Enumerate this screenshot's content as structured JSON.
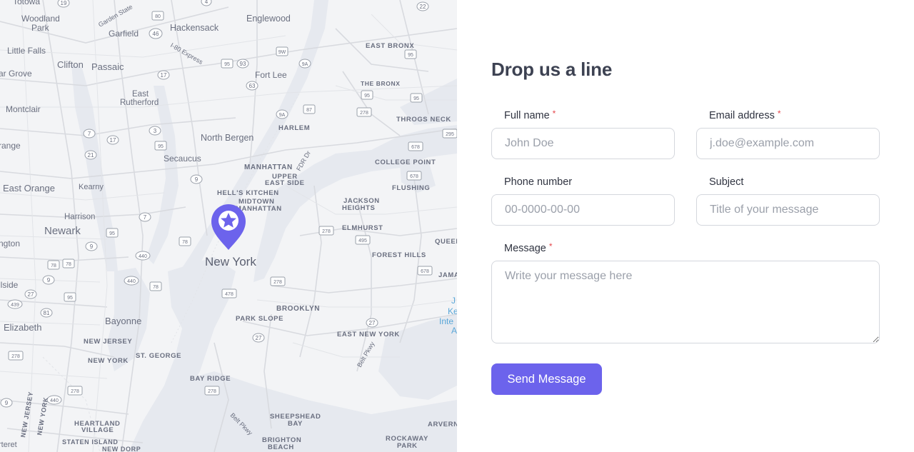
{
  "map": {
    "marker_icon": "map-pin-star-icon",
    "colors": {
      "land": "#f2f3f5",
      "water": "#e4e7ee",
      "road": "#d9dbe0",
      "marker": "#6c63ec"
    },
    "labels": {
      "totowa": "Totowa",
      "woodland_park_1": "Woodland",
      "woodland_park_2": "Park",
      "garfield": "Garfield",
      "hackensack": "Hackensack",
      "englewood": "Englewood",
      "little_falls": "Little Falls",
      "clifton": "Clifton",
      "passaic": "Passaic",
      "fort_lee": "Fort Lee",
      "east_bronx": "EAST BRONX",
      "the_bronx": "THE BRONX",
      "grove": "ar Grove",
      "east_rutherford_1": "East",
      "east_rutherford_2": "Rutherford",
      "montclair": "Montclair",
      "harlem": "HARLEM",
      "throgs_neck": "THROGS NECK",
      "north_bergen": "North Bergen",
      "range": "range",
      "secaucus": "Secaucus",
      "manhattan": "MANHATTAN",
      "upper_east_side_1": "UPPER",
      "upper_east_side_2": "EAST SIDE",
      "college_point": "COLLEGE POINT",
      "flushing": "FLUSHING",
      "east_orange": "East Orange",
      "kearny": "Kearny",
      "hells_kitchen": "HELL'S KITCHEN",
      "midtown_1": "MIDTOWN",
      "midtown_2": "MANHATTAN",
      "jackson_heights_1": "JACKSON",
      "jackson_heights_2": "HEIGHTS",
      "harrison": "Harrison",
      "newark": "Newark",
      "elmhurst": "ELMHURST",
      "queens": "QUEEN",
      "ington": "ngton",
      "new_york": "New York",
      "forest_hills": "FOREST HILLS",
      "jamaica": "JAMA",
      "llside": "llside",
      "brooklyn": "BROOKLYN",
      "park_slope": "PARK SLOPE",
      "bayonne": "Bayonne",
      "elizabeth": "Elizabeth",
      "east_new_york": "EAST NEW YORK",
      "new_jersey": "NEW JERSEY",
      "st_george": "ST. GEORGE",
      "new_york_state": "NEW YORK",
      "bay_ridge": "BAY RIDGE",
      "belt_pkwy": "Belt Pkwy",
      "sheepshead_bay_1": "SHEEPSHEAD",
      "sheepshead_bay_2": "BAY",
      "heartland_village_1": "HEARTLAND",
      "heartland_village_2": "VILLAGE",
      "staten_island": "STATEN ISLAND",
      "brighton_beach_1": "BRIGHTON",
      "brighton_beach_2": "BEACH",
      "rockaway_park_1": "ROCKAWAY",
      "rockaway_park_2": "PARK",
      "arverne": "ARVERN",
      "new_dorp": "NEW DORP",
      "carteret": "rteret",
      "fdr_dr": "FDR Dr",
      "i80_express": "I-80 Express",
      "garden_state": "Garden State",
      "belt_pkwy_2": "Belt Pkwy",
      "new_jersey_vertical": "NEW JERSEY",
      "new_york_vertical": "NEW YORK",
      "jfk_1": "J",
      "jfk_2": "Ke",
      "jfk_3": "Inte",
      "jfk_4": "A"
    },
    "shields": [
      "19",
      "4",
      "22",
      "80",
      "46",
      "95",
      "95",
      "9W",
      "93",
      "9A",
      "95",
      "95",
      "17",
      "63",
      "87",
      "278",
      "95",
      "7",
      "17",
      "3",
      "9A",
      "295",
      "678",
      "21",
      "95",
      "9",
      "678",
      "7",
      "78",
      "95",
      "9",
      "278",
      "495",
      "440",
      "278",
      "678",
      "78",
      "78",
      "9",
      "440",
      "78",
      "27",
      "95",
      "439",
      "81",
      "478",
      "27",
      "278",
      "9",
      "278",
      "440",
      "278",
      "27"
    ]
  },
  "form": {
    "title": "Drop us a line",
    "full_name": {
      "label": "Full name",
      "required_mark": "*",
      "placeholder": "John Doe",
      "value": ""
    },
    "email": {
      "label": "Email address",
      "required_mark": "*",
      "placeholder": "j.doe@example.com",
      "value": ""
    },
    "phone": {
      "label": "Phone number",
      "placeholder": "00-0000-00-00",
      "value": ""
    },
    "subject": {
      "label": "Subject",
      "placeholder": "Title of your message",
      "value": ""
    },
    "message": {
      "label": "Message",
      "required_mark": "*",
      "placeholder": "Write your message here",
      "value": ""
    },
    "submit_label": "Send Message",
    "colors": {
      "accent": "#6c63ec",
      "required": "#e5484d"
    }
  }
}
